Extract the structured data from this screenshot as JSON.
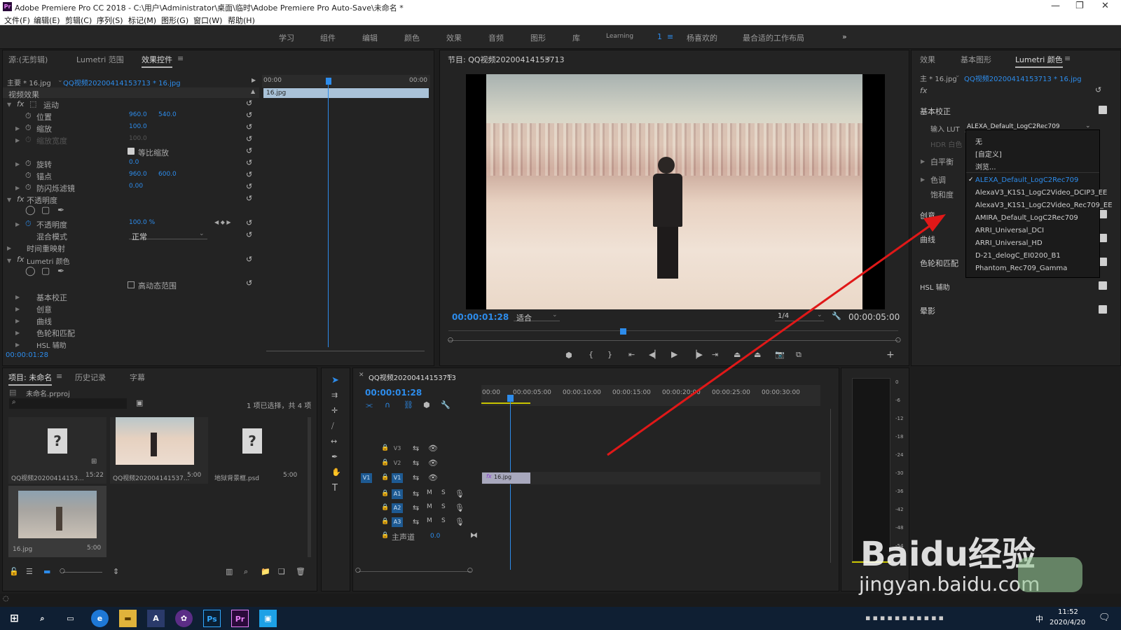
{
  "title_bar": {
    "app_icon": "Pr",
    "title": "Adobe Premiere Pro CC 2018 - C:\\用户\\Administrator\\桌面\\临时\\Adobe Premiere Pro Auto-Save\\未命名 *"
  },
  "menu": [
    "文件(F)",
    "编辑(E)",
    "剪辑(C)",
    "序列(S)",
    "标记(M)",
    "图形(G)",
    "窗口(W)",
    "帮助(H)"
  ],
  "workspaces": [
    "学习",
    "组件",
    "编辑",
    "颜色",
    "效果",
    "音频",
    "图形",
    "库",
    "Learning",
    "1",
    "杨喜欢的",
    "最合适的工作布局"
  ],
  "source_panel": {
    "tabs": [
      "源:(无剪辑)",
      "Lumetri 范围",
      "效果控件"
    ],
    "master": "主要 * 16.jpg",
    "clip": "QQ视频20200414153713 * 16.jpg",
    "time_start": "00:00",
    "time_end": "00:00",
    "clip_bar": "16.jpg",
    "section": "视频效果",
    "timecode": "00:00:01:28"
  },
  "effects": {
    "motion": "运动",
    "position": "位置",
    "position_x": "960.0",
    "position_y": "540.0",
    "scale": "缩放",
    "scale_val": "100.0",
    "scale_width": "缩放宽度",
    "scale_width_val": "100.0",
    "uniform": "等比缩放",
    "rotation": "旋转",
    "rotation_val": "0.0",
    "anchor": "锚点",
    "anchor_x": "960.0",
    "anchor_y": "600.0",
    "flicker": "防闪烁滤镜",
    "flicker_val": "0.00",
    "opacity_group": "不透明度",
    "opacity": "不透明度",
    "opacity_val": "100.0 %",
    "blend": "混合模式",
    "blend_val": "正常",
    "time_remap": "时间重映射",
    "lumetri": "Lumetri 颜色",
    "hdr": "高动态范围",
    "sub": [
      "基本校正",
      "创意",
      "曲线",
      "色轮和匹配",
      "HSL 辅助"
    ]
  },
  "program": {
    "title": "节目: QQ视频20200414153713",
    "timecode": "00:00:01:28",
    "fit": "适合",
    "quality": "1/4",
    "duration": "00:00:05:00"
  },
  "lumetri": {
    "tabs": [
      "效果",
      "基本图形",
      "Lumetri 颜色"
    ],
    "master": "主 * 16.jpg",
    "clip": "QQ视频20200414153713 * 16.jpg",
    "fx": "fx",
    "basic": "基本校正",
    "input_lut": "输入 LUT",
    "lut_val": "ALEXA_Default_LogC2Rec709",
    "hdr_white": "HDR 白色",
    "white_balance": "白平衡",
    "tone": "色调",
    "saturation": "饱和度",
    "creative": "创意",
    "curves": "曲线",
    "wheels": "色轮和匹配",
    "hsl": "HSL 辅助",
    "vignette": "晕影"
  },
  "lut_dropdown": [
    "无",
    "[自定义]",
    "浏览...",
    "ALEXA_Default_LogC2Rec709",
    "AlexaV3_K1S1_LogC2Video_DCIP3_EE",
    "AlexaV3_K1S1_LogC2Video_Rec709_EE",
    "AMIRA_Default_LogC2Rec709",
    "ARRI_Universal_DCI",
    "ARRI_Universal_HD",
    "D-21_delogC_EI0200_B1",
    "Phantom_Rec709_Gamma"
  ],
  "project": {
    "tabs": [
      "项目: 未命名",
      "历史记录",
      "字幕"
    ],
    "file": "未命名.prproj",
    "count": "1 项已选择，共 4 项",
    "items": [
      {
        "name": "QQ视频20200414153...",
        "dur": "15:22"
      },
      {
        "name": "QQ视频202004141537...",
        "dur": "5:00"
      },
      {
        "name": "地狱背景框.psd",
        "dur": "5:00"
      },
      {
        "name": "16.jpg",
        "dur": "5:00"
      }
    ]
  },
  "timeline": {
    "tab": "QQ视频20200414153713",
    "timecode": "00:00:01:28",
    "ruler": [
      "00:00",
      "00:00:05:00",
      "00:00:10:00",
      "00:00:15:00",
      "00:00:20:00",
      "00:00:25:00",
      "00:00:30:00"
    ],
    "tracks": [
      "V3",
      "V2",
      "V1",
      "A1",
      "A2",
      "A3"
    ],
    "master": "主声道",
    "master_val": "0.0",
    "clip": "16.jpg",
    "v1_src": "V1"
  },
  "meter": [
    "0",
    "-6",
    "-12",
    "-18",
    "-24",
    "-30",
    "-36",
    "-42",
    "-48",
    "-54"
  ],
  "watermark": {
    "brand": "Baidu经验",
    "url": "jingyan.baidu.com"
  },
  "taskbar": {
    "time": "11:52",
    "date": "2020/4/20",
    "ime": "中"
  }
}
